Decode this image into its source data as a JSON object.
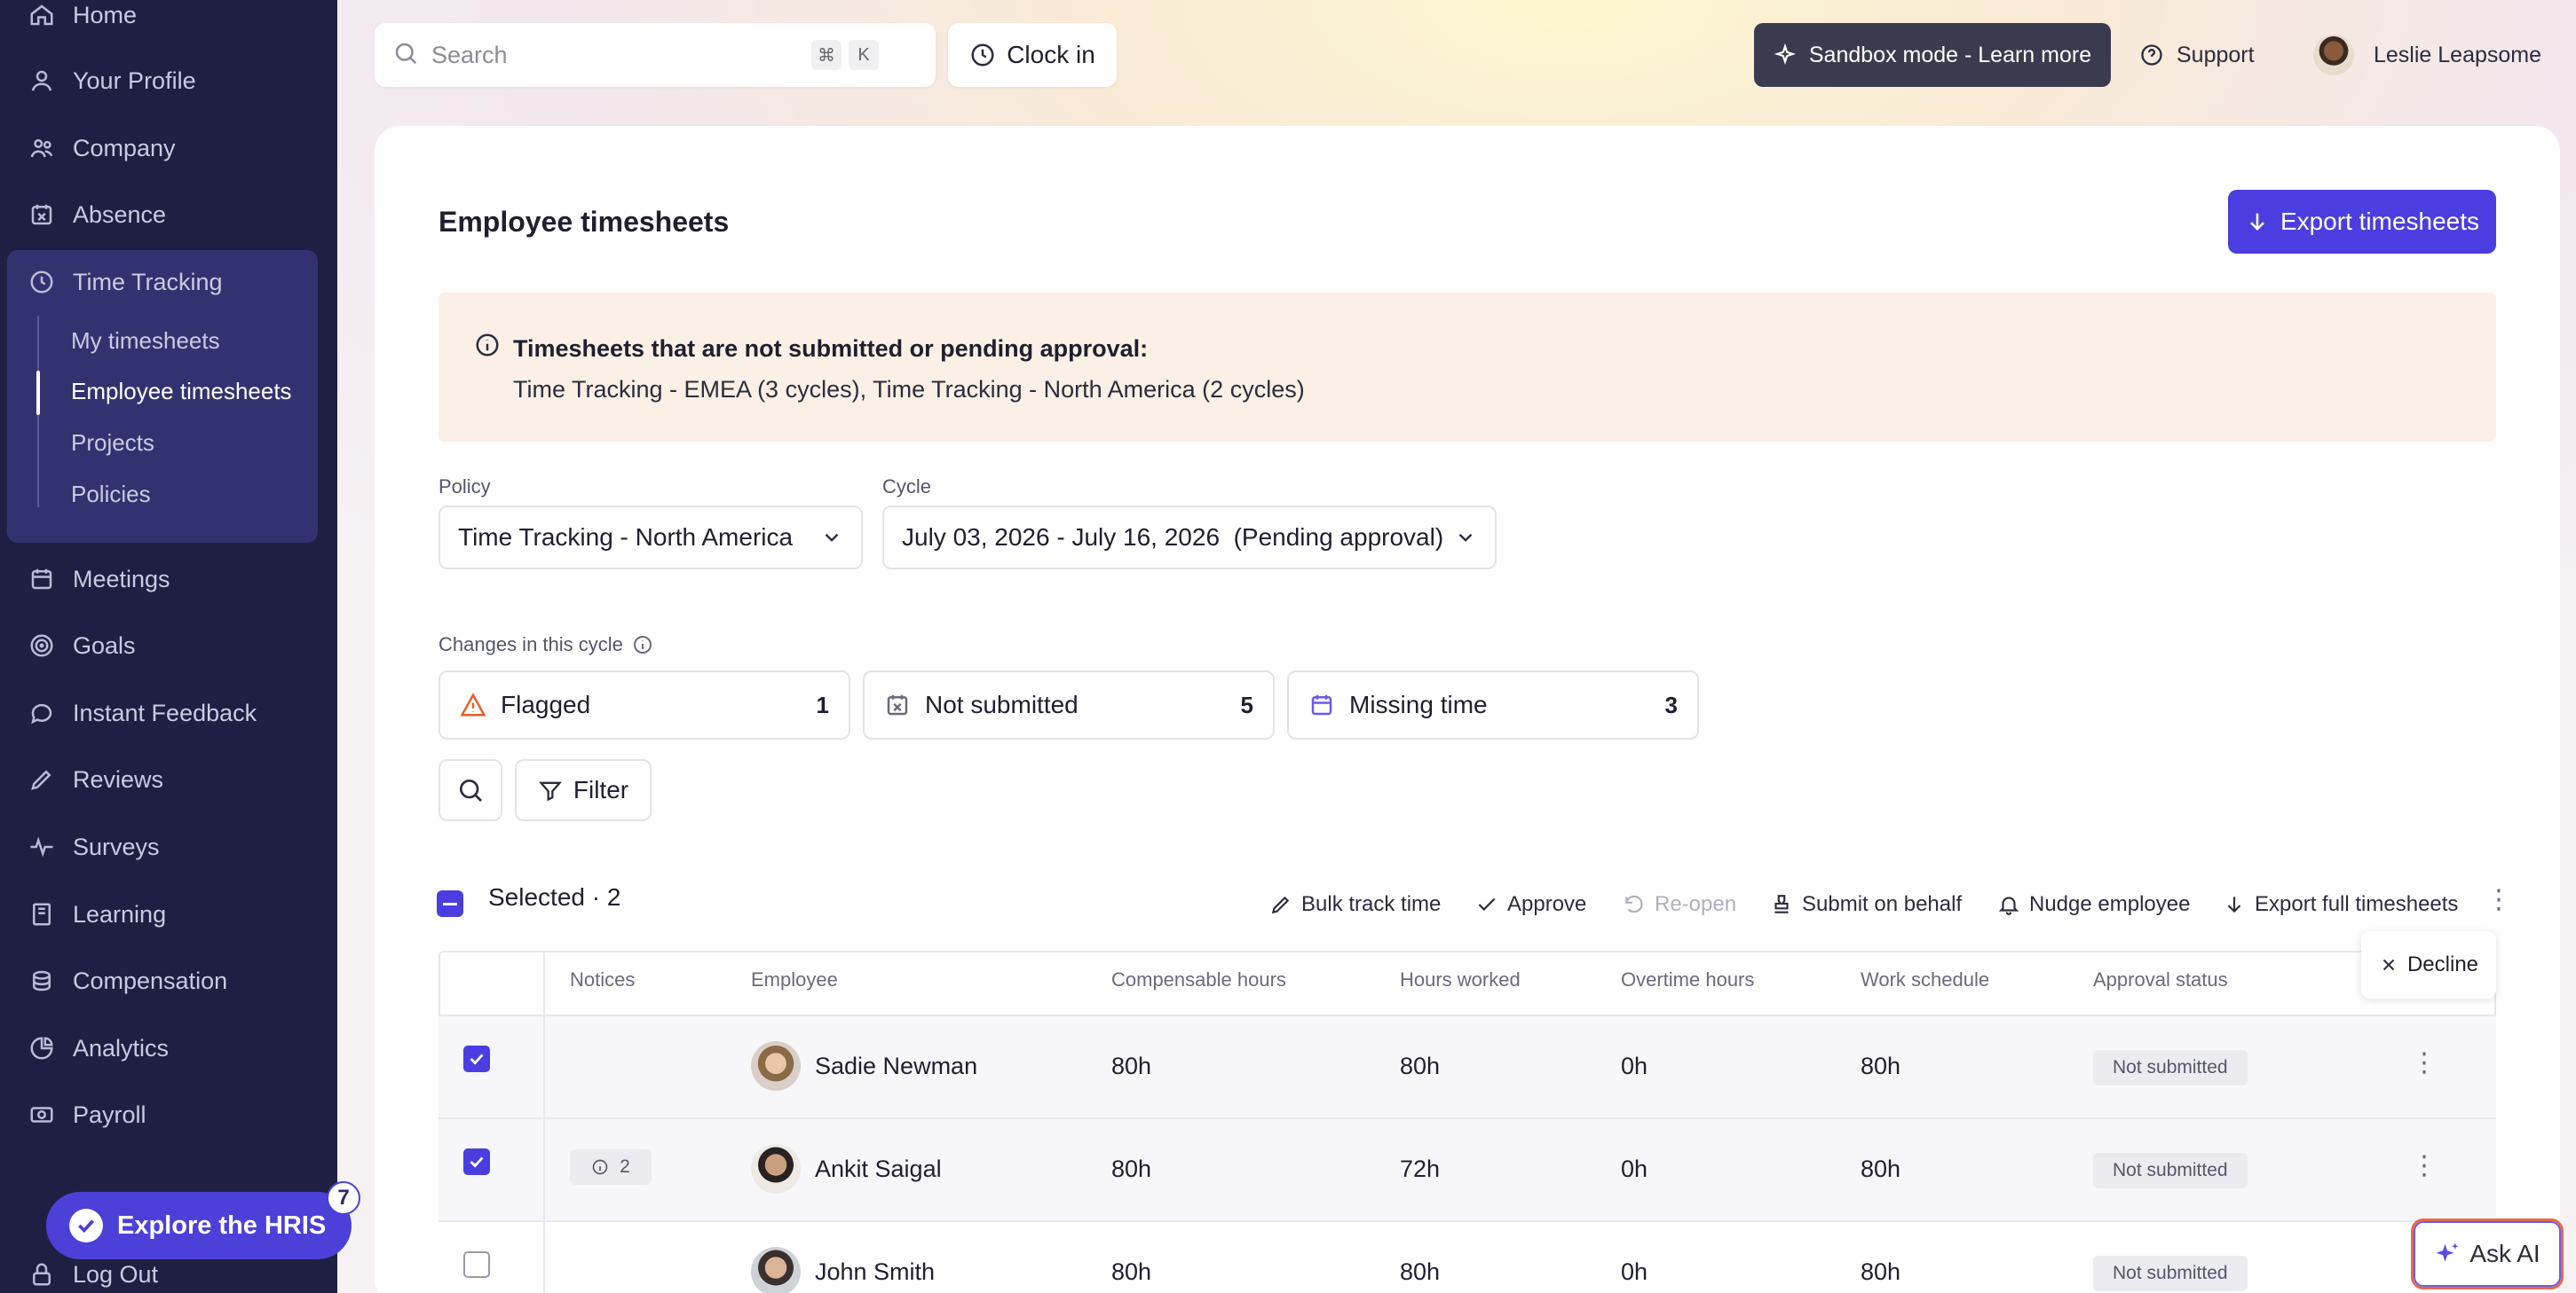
{
  "sidebar": {
    "items": [
      {
        "label": "Home",
        "icon": "home-icon"
      },
      {
        "label": "Your Profile",
        "icon": "user-icon"
      },
      {
        "label": "Company",
        "icon": "people-icon"
      },
      {
        "label": "Absence",
        "icon": "calendar-x-icon"
      },
      {
        "label": "Time Tracking",
        "icon": "clock-icon"
      },
      {
        "label": "Meetings",
        "icon": "calendar-icon"
      },
      {
        "label": "Goals",
        "icon": "target-icon"
      },
      {
        "label": "Instant Feedback",
        "icon": "chat-icon"
      },
      {
        "label": "Reviews",
        "icon": "pencil-icon"
      },
      {
        "label": "Surveys",
        "icon": "pulse-icon"
      },
      {
        "label": "Learning",
        "icon": "book-icon"
      },
      {
        "label": "Compensation",
        "icon": "coins-icon"
      },
      {
        "label": "Analytics",
        "icon": "chart-icon"
      },
      {
        "label": "Payroll",
        "icon": "money-icon"
      },
      {
        "label": "Log Out",
        "icon": "lock-icon"
      }
    ],
    "time_tracking_sub": [
      {
        "label": "My timesheets"
      },
      {
        "label": "Employee timesheets"
      },
      {
        "label": "Projects"
      },
      {
        "label": "Policies"
      }
    ],
    "explore_label": "Explore the HRIS",
    "explore_badge": "7"
  },
  "topbar": {
    "search_placeholder": "Search",
    "kbd_cmd": "⌘",
    "kbd_k": "K",
    "clock_in": "Clock in",
    "sandbox": "Sandbox mode - Learn more",
    "support": "Support",
    "user_name": "Leslie Leapsome"
  },
  "page": {
    "title": "Employee timesheets",
    "export_button": "Export timesheets",
    "notice_title": "Timesheets that are not submitted or pending approval:",
    "notice_text": "Time Tracking - EMEA (3 cycles), Time Tracking - North America (2 cycles)",
    "policy_label": "Policy",
    "policy_value": "Time Tracking - North America",
    "cycle_label": "Cycle",
    "cycle_value": "July 03, 2026 - July 16, 2026  (Pending approval)",
    "changes_label": "Changes in this cycle",
    "chips": [
      {
        "label": "Flagged",
        "count": "1"
      },
      {
        "label": "Not submitted",
        "count": "5"
      },
      {
        "label": "Missing time",
        "count": "3"
      }
    ],
    "filter_label": "Filter",
    "selected_label": "Selected · 2",
    "bulk_actions": {
      "bulk_track": "Bulk track time",
      "approve": "Approve",
      "reopen": "Re-open",
      "submit_behalf": "Submit on behalf",
      "nudge": "Nudge employee",
      "export_full": "Export full timesheets"
    },
    "decline": "Decline"
  },
  "table": {
    "headers": {
      "notices": "Notices",
      "employee": "Employee",
      "compensable": "Compensable hours",
      "worked": "Hours worked",
      "overtime": "Overtime hours",
      "schedule": "Work schedule",
      "approval": "Approval status"
    },
    "rows": [
      {
        "name": "Sadie Newman",
        "notices": "",
        "compensable": "80h",
        "worked": "80h",
        "overtime": "0h",
        "schedule": "80h",
        "status": "Not submitted",
        "checked": true
      },
      {
        "name": "Ankit Saigal",
        "notices": "2",
        "compensable": "80h",
        "worked": "72h",
        "overtime": "0h",
        "schedule": "80h",
        "status": "Not submitted",
        "checked": true
      },
      {
        "name": "John Smith",
        "notices": "",
        "compensable": "80h",
        "worked": "80h",
        "overtime": "0h",
        "schedule": "80h",
        "status": "Not submitted",
        "checked": false
      }
    ]
  },
  "ask_ai": "Ask AI",
  "colors": {
    "sidebar_bg": "#1f1f44",
    "accent": "#4b3ee0",
    "notice_bg": "#fbf0e6"
  }
}
